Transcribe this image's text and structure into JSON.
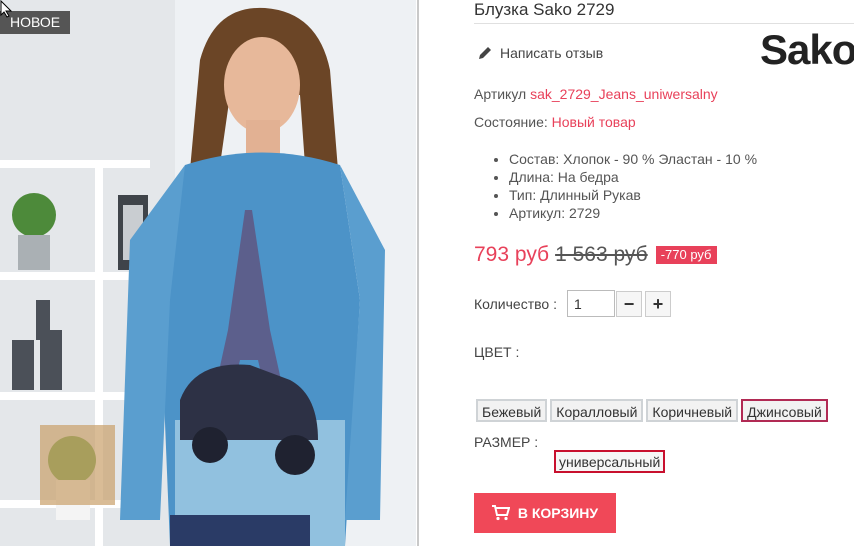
{
  "product": {
    "badge": "НОВОЕ",
    "title": "Блузка Sako 2729",
    "review_link": "Написать отзыв",
    "brand": "Sako",
    "article_label": "Артикул",
    "article_value": "sak_2729_Jeans_uniwersalny",
    "condition_label": "Состояние:",
    "condition_value": "Новый товар",
    "properties": [
      "Состав: Хлопок - 90 % Эластан - 10 %",
      "Длина: На бедра",
      "Тип: Длинный Рукав",
      "Артикул: 2729"
    ],
    "price": "793 руб",
    "old_price": "1 563 руб",
    "discount": "-770 руб",
    "quantity_label": "Количество :",
    "quantity_value": "1",
    "minus": "−",
    "plus": "+",
    "color_label": "ЦВЕТ :",
    "colors": [
      "Бежевый",
      "Коралловый",
      "Коричневый",
      "Джинсовый"
    ],
    "selected_color": "Джинсовый",
    "size_label": "РАЗМЕР :",
    "size_value": "универсальный",
    "add_to_cart": "В КОРЗИНУ"
  },
  "icons": {
    "review": "pencil-icon",
    "cart": "cart-icon",
    "cursor": "mouse-cursor-icon"
  },
  "colors": {
    "accent": "#e8415a",
    "button": "#f04858",
    "selected_color_border": "#b12a54",
    "size_border": "#c8102e",
    "badge": "#555555"
  }
}
